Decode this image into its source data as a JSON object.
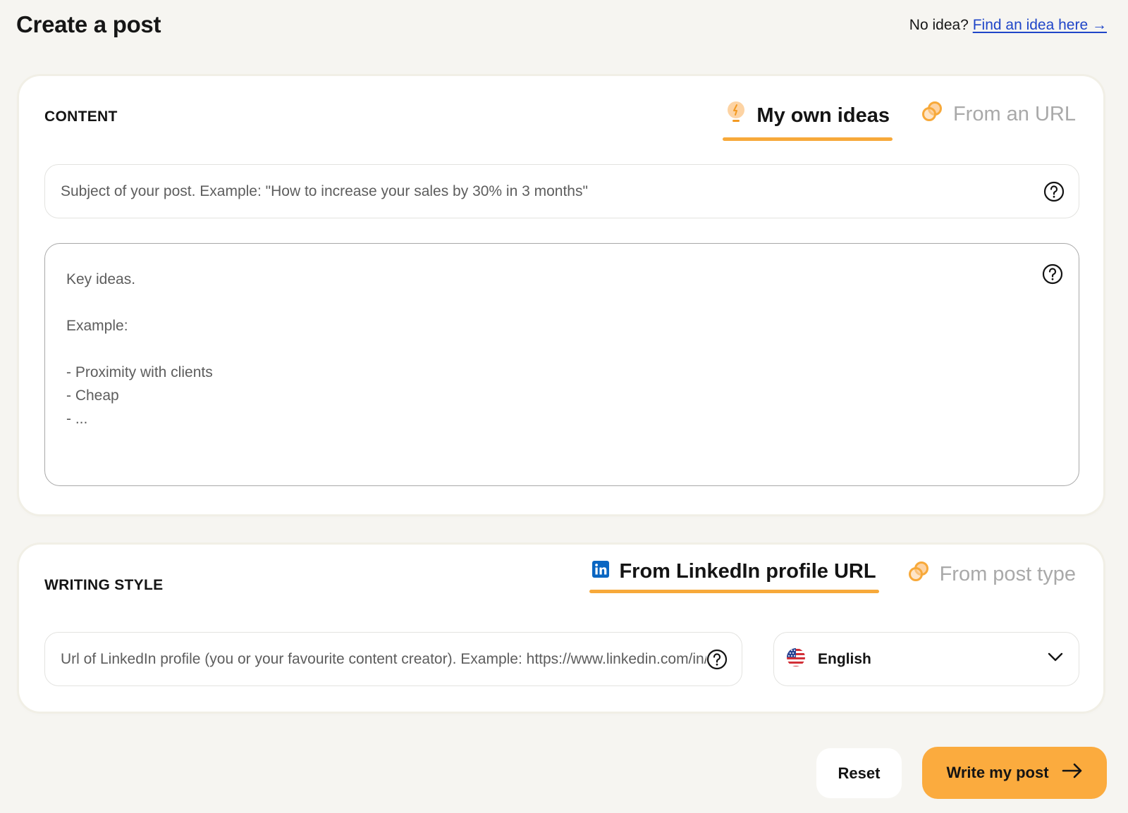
{
  "header": {
    "title": "Create a post",
    "no_idea_text": "No idea?",
    "find_idea_link": "Find an idea here →"
  },
  "content": {
    "section_label": "CONTENT",
    "tabs": [
      {
        "label": "My own ideas",
        "icon": "lightbulb-icon",
        "active": true
      },
      {
        "label": "From an URL",
        "icon": "link-icon",
        "active": false
      }
    ],
    "subject_input": {
      "value": "",
      "placeholder": "Subject of your post. Example: \"How to increase your sales by 30% in 3 months\""
    },
    "ideas_textarea": {
      "value": "",
      "placeholder": "Key ideas.\n\nExample:\n\n- Proximity with clients\n- Cheap\n- ..."
    }
  },
  "writing_style": {
    "section_label": "WRITING STYLE",
    "tabs": [
      {
        "label": "From LinkedIn profile URL",
        "icon": "linkedin-icon",
        "active": true
      },
      {
        "label": "From post type",
        "icon": "link-icon",
        "active": false
      }
    ],
    "linkedin_input": {
      "value": "",
      "placeholder": "Url of LinkedIn profile (you or your favourite content creator). Example: https://www.linkedin.com/in/"
    },
    "language_select": {
      "selected": "English",
      "icon": "us-flag-icon"
    }
  },
  "actions": {
    "reset_label": "Reset",
    "write_label": "Write my post"
  },
  "colors": {
    "accent": "#fbab3e",
    "tab_underline": "#f7a93a",
    "link": "#1f45c8",
    "background": "#f6f5f1",
    "linkedin_blue": "#0a66c2"
  }
}
